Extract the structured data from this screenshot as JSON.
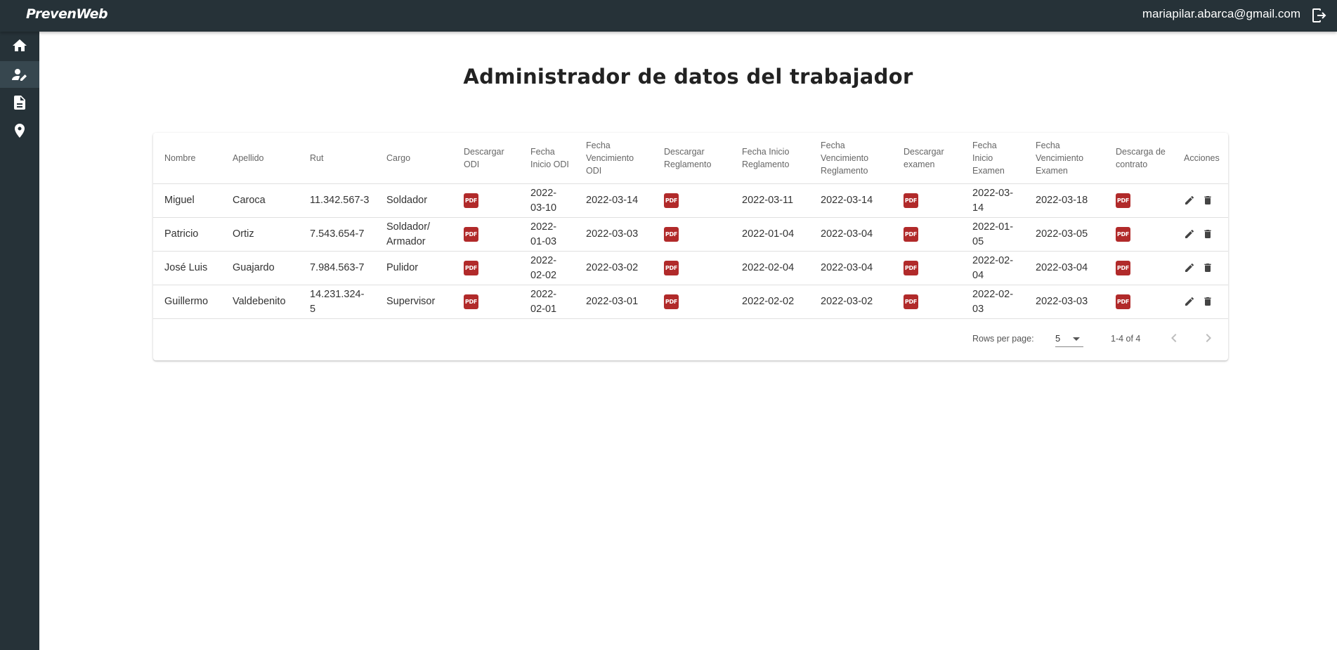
{
  "app": {
    "brand": "PrevenWeb",
    "user_email": "mariapilar.abarca@gmail.com"
  },
  "icons": {
    "logout": "logout-icon",
    "home": "home-icon",
    "worker": "person-edit-icon",
    "document": "document-icon",
    "location": "location-pin-icon",
    "edit": "pencil-icon",
    "delete": "trash-icon",
    "prev": "chevron-left-icon",
    "next": "chevron-right-icon"
  },
  "colors": {
    "sidebar": "#263238",
    "pdf": "#b12a2a"
  },
  "page": {
    "title": "Administrador de datos del trabajador"
  },
  "table": {
    "headers": {
      "nombre": "Nombre",
      "apellido": "Apellido",
      "rut": "Rut",
      "cargo": "Cargo",
      "descargar_odi": "Descargar ODI",
      "fecha_inicio_odi": "Fecha Inicio ODI",
      "fecha_vencimiento_odi": "Fecha Vencimiento ODI",
      "descargar_reglamento": "Descargar Reglamento",
      "fecha_inicio_reglamento": "Fecha Inicio Reglamento",
      "fecha_vencimiento_reglamento": "Fecha Vencimiento Reglamento",
      "descargar_examen": "Descargar examen",
      "fecha_inicio_examen": "Fecha Inicio Examen",
      "fecha_vencimiento_examen": "Fecha Vencimiento Examen",
      "descarga_contrato": "Descarga de contrato",
      "acciones": "Acciones"
    },
    "pdf_label": "PDF",
    "rows": [
      {
        "nombre": "Miguel",
        "apellido": "Caroca",
        "rut": "11.342.567-3",
        "cargo": "Soldador",
        "fecha_inicio_odi": "2022-03-10",
        "fecha_vencimiento_odi": "2022-03-14",
        "fecha_inicio_reglamento": "2022-03-11",
        "fecha_vencimiento_reglamento": "2022-03-14",
        "fecha_inicio_examen": "2022-03-14",
        "fecha_vencimiento_examen": "2022-03-18"
      },
      {
        "nombre": "Patricio",
        "apellido": "Ortiz",
        "rut": "7.543.654-7",
        "cargo": "Soldador/ Armador",
        "fecha_inicio_odi": "2022-01-03",
        "fecha_vencimiento_odi": "2022-03-03",
        "fecha_inicio_reglamento": "2022-01-04",
        "fecha_vencimiento_reglamento": "2022-03-04",
        "fecha_inicio_examen": "2022-01-05",
        "fecha_vencimiento_examen": "2022-03-05"
      },
      {
        "nombre": "José Luis",
        "apellido": "Guajardo",
        "rut": "7.984.563-7",
        "cargo": "Pulidor",
        "fecha_inicio_odi": "2022-02-02",
        "fecha_vencimiento_odi": "2022-03-02",
        "fecha_inicio_reglamento": "2022-02-04",
        "fecha_vencimiento_reglamento": "2022-03-04",
        "fecha_inicio_examen": "2022-02-04",
        "fecha_vencimiento_examen": "2022-03-04"
      },
      {
        "nombre": "Guillermo",
        "apellido": "Valdebenito",
        "rut": "14.231.324-5",
        "cargo": "Supervisor",
        "fecha_inicio_odi": "2022-02-01",
        "fecha_vencimiento_odi": "2022-03-01",
        "fecha_inicio_reglamento": "2022-02-02",
        "fecha_vencimiento_reglamento": "2022-03-02",
        "fecha_inicio_examen": "2022-02-03",
        "fecha_vencimiento_examen": "2022-03-03"
      }
    ]
  },
  "pagination": {
    "rows_per_page_label": "Rows per page:",
    "rows_per_page": "5",
    "range": "1-4 of 4"
  }
}
